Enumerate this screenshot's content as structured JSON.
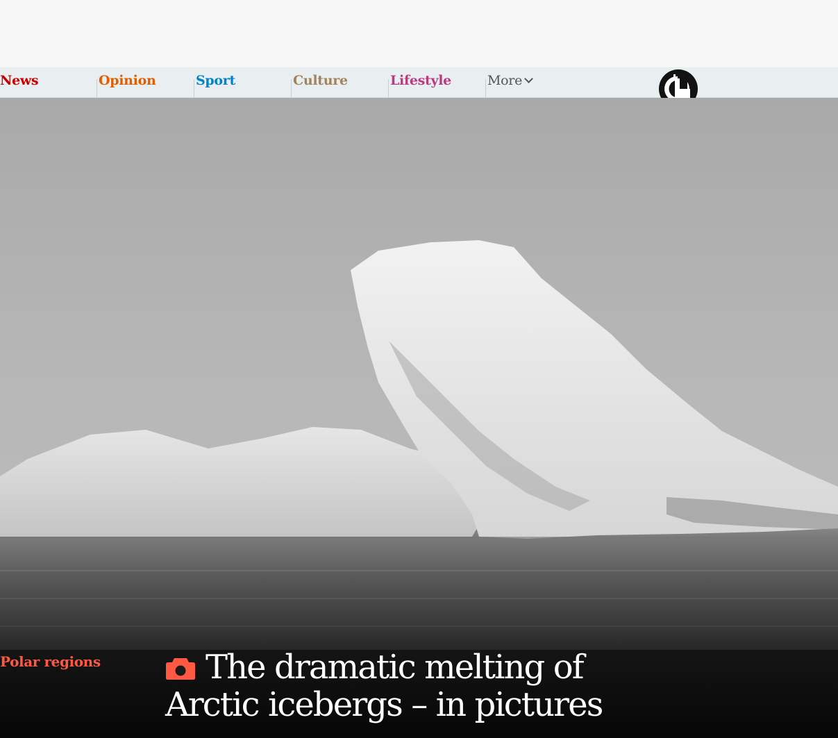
{
  "nav": {
    "items": [
      {
        "label": "News",
        "color": "#c70000"
      },
      {
        "label": "Opinion",
        "color": "#e05e00"
      },
      {
        "label": "Sport",
        "color": "#0084c6"
      },
      {
        "label": "Culture",
        "color": "#a1845c"
      },
      {
        "label": "Lifestyle",
        "color": "#bb3b80"
      }
    ],
    "more_label": "More",
    "more_icon": "chevron-down-icon",
    "logo_icon": "guardian-g-logo"
  },
  "article": {
    "kicker": "Polar regions",
    "kicker_color": "#ff5943",
    "headline": "The dramatic melting of Arctic icebergs – in pictures",
    "media_icon": "camera-icon"
  },
  "hero_image": {
    "icon": "iceberg-photo"
  }
}
